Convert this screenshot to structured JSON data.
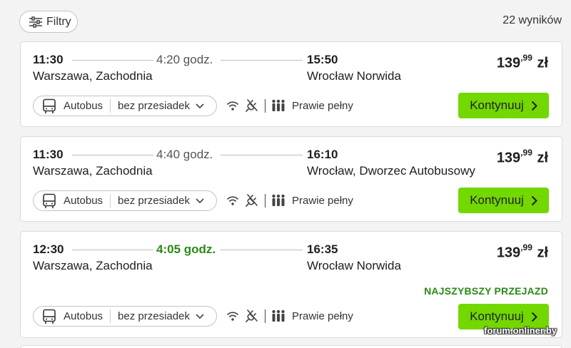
{
  "filter": {
    "label": "Filtry"
  },
  "results": {
    "count_label": "22 wyników"
  },
  "trips": [
    {
      "departure_time": "11:30",
      "departure_station": "Warszawa, Zachodnia",
      "duration": "4:20 godz.",
      "arrival_time": "15:50",
      "arrival_station": "Wrocław Norwida",
      "price_main": "139",
      "price_cents": ",99",
      "currency": "zł",
      "vehicle": "Autobus",
      "transfers": "bez przesiadek",
      "occupancy": "Prawie pełny",
      "cta": "Kontynuuj"
    },
    {
      "departure_time": "11:30",
      "departure_station": "Warszawa, Zachodnia",
      "duration": "4:40 godz.",
      "arrival_time": "16:10",
      "arrival_station": "Wrocław, Dworzec Autobusowy",
      "price_main": "139",
      "price_cents": ",99",
      "currency": "zł",
      "vehicle": "Autobus",
      "transfers": "bez przesiadek",
      "occupancy": "Prawie pełny",
      "cta": "Kontynuuj"
    },
    {
      "departure_time": "12:30",
      "departure_station": "Warszawa, Zachodnia",
      "duration": "4:05 godz.",
      "arrival_time": "16:35",
      "arrival_station": "Wrocław Norwida",
      "price_main": "139",
      "price_cents": ",99",
      "currency": "zł",
      "badge": "NAJSZYBSZY PRZEJAZD",
      "vehicle": "Autobus",
      "transfers": "bez przesiadek",
      "occupancy": "Prawie pełny",
      "cta": "Kontynuuj"
    }
  ],
  "icons": [
    "filter-sliders-icon",
    "bus-icon",
    "chevron-down-icon",
    "wifi-icon",
    "power-plug-icon",
    "occupancy-people-icon",
    "chevron-right-icon"
  ],
  "colors": {
    "accent_green": "#73d700",
    "fast_green": "#2a8a16"
  },
  "watermark": "forum.onliner.by"
}
